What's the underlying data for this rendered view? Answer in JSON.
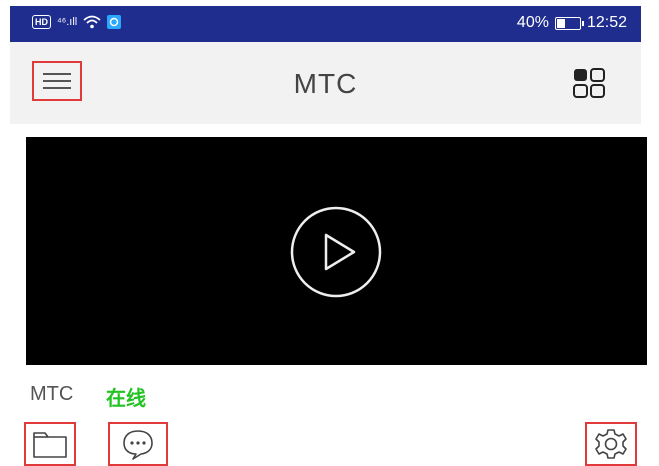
{
  "status_bar": {
    "hd_badge": "HD",
    "network": "⁴⁶.ıll",
    "battery_percent": "40%",
    "battery_level": 0.4,
    "time": "12:52"
  },
  "app_bar": {
    "title": "MTC"
  },
  "device": {
    "name": "MTC",
    "status": "在线"
  },
  "colors": {
    "status_bar": "#1f2d8f",
    "online_green": "#22c322",
    "highlight_red": "#e03a3a"
  }
}
